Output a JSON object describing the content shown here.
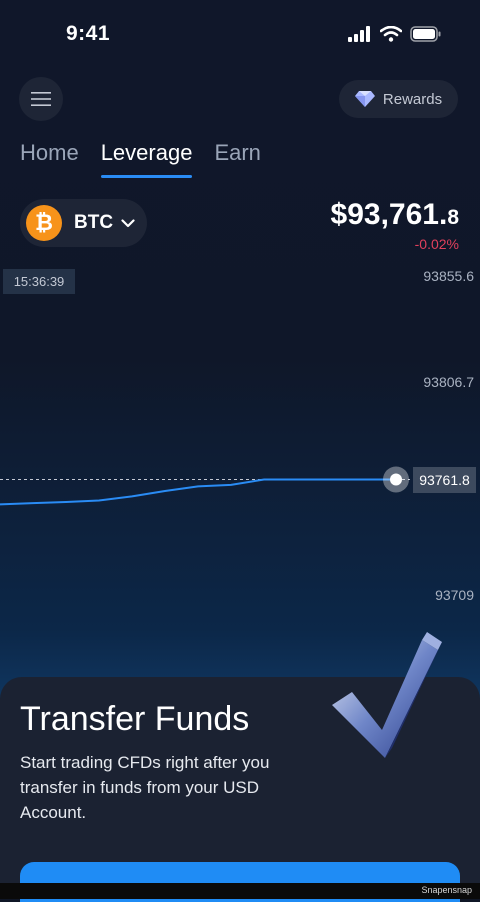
{
  "status_bar": {
    "time": "9:41"
  },
  "header": {
    "menu_icon": "hamburger-icon",
    "rewards_label": "Rewards",
    "rewards_icon": "diamond-icon"
  },
  "tabs": [
    {
      "label": "Home",
      "active": false
    },
    {
      "label": "Leverage",
      "active": true
    },
    {
      "label": "Earn",
      "active": false
    }
  ],
  "asset": {
    "symbol": "BTC",
    "icon_glyph": "₿",
    "price_main": "$93,761.",
    "price_decimal": "8",
    "change": "-0.02%"
  },
  "chart": {
    "time_label": "15:36:39",
    "ticks": [
      "93855.6",
      "93806.7",
      "93761.8",
      "93709"
    ],
    "current_price_tag": "93761.8"
  },
  "chart_data": {
    "type": "line",
    "x": [
      "15:36:39"
    ],
    "series": [
      {
        "values": [
          93750.3,
          93750.9,
          93751.4,
          93752.1,
          93754.0,
          93756.5,
          93758.6,
          93759.3,
          93761.8,
          93761.8,
          93761.8,
          93761.8,
          93761.8
        ]
      }
    ],
    "ylim": [
      93690,
      93870
    ],
    "grid": false,
    "colors": {
      "line": "#2a8cf5",
      "current_marker": "#ffffff"
    }
  },
  "card": {
    "title": "Transfer Funds",
    "body": "Start trading CFDs right after you transfer in funds from your USD Account.",
    "art_icon": "checkmark-3d-icon"
  },
  "footer": {
    "watermark": "Snapensnap"
  },
  "colors": {
    "accent": "#2a8cf5",
    "negative": "#e0405c",
    "btc": "#f7931a"
  }
}
